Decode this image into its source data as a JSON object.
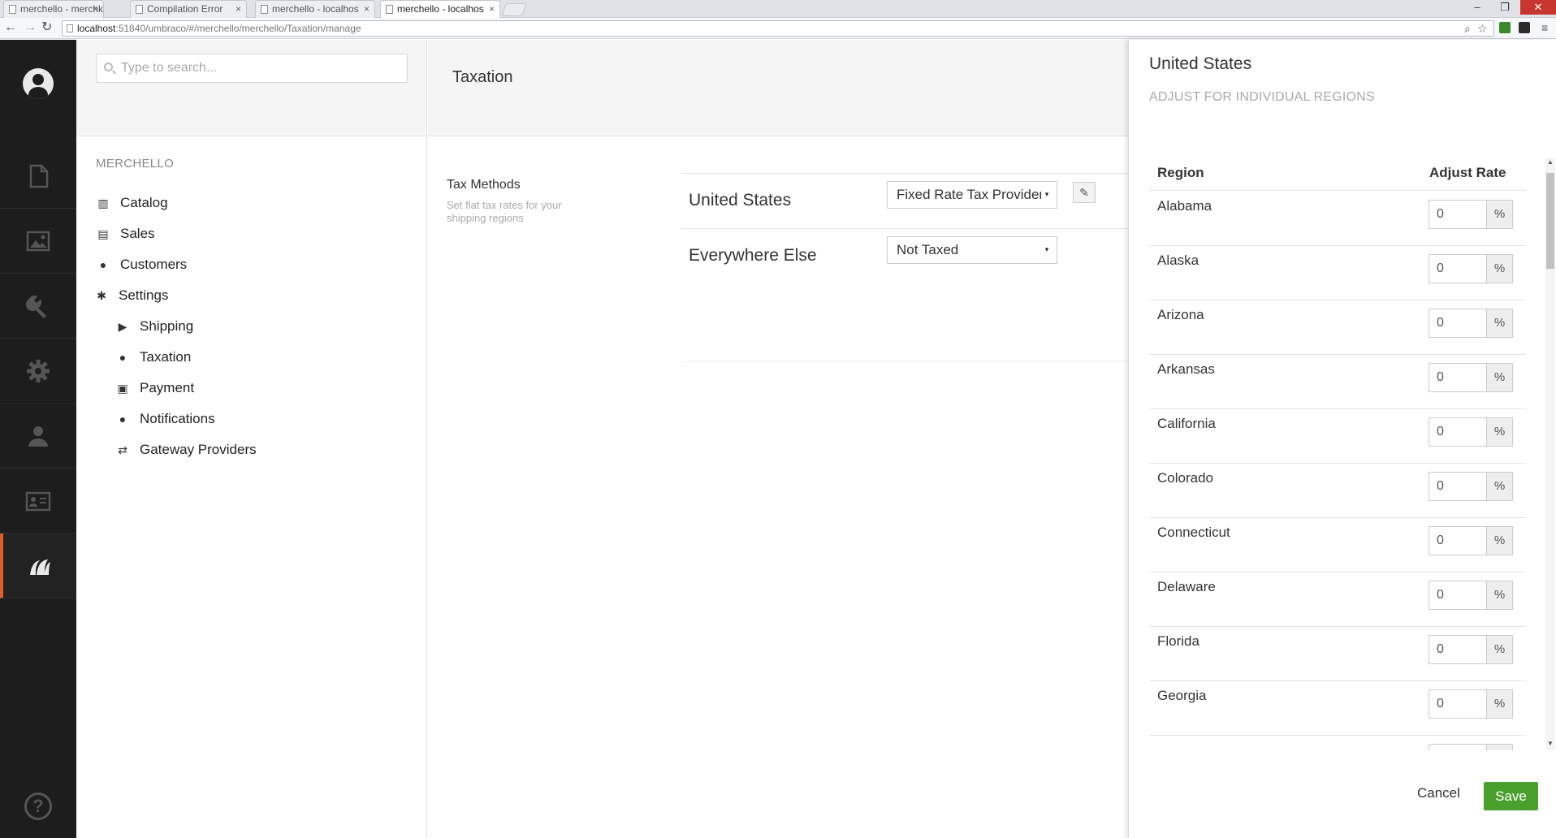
{
  "browser": {
    "tabs": [
      {
        "label": "merchello - merchkit",
        "active": false
      },
      {
        "label": "Compilation Error",
        "active": false
      },
      {
        "label": "merchello - localhos",
        "active": false
      },
      {
        "label": "merchello - localhos",
        "active": true
      }
    ],
    "tab_close": "×",
    "url_host": "localhost",
    "url_rest": ":51840/umbraco/#/merchello/merchello/Taxation/manage",
    "window_controls": {
      "minimize": "–",
      "restore": "❐",
      "close": "✕"
    },
    "nav": {
      "back": "←",
      "forward": "→",
      "reload": "↻"
    },
    "toolbar_icons": {
      "zoom": "⌕",
      "star": "☆",
      "menu": "≡"
    },
    "extension_colors": [
      "#3a8a2c",
      "#2b2b2b"
    ]
  },
  "sections": {
    "icons": [
      "document-icon",
      "media-icon",
      "wrench-icon",
      "gear-icon",
      "user-icon",
      "member-card-icon",
      "merchello-icon"
    ],
    "active_index": 6,
    "accent_color": "#e05c28",
    "help_label": "?"
  },
  "tree": {
    "search_placeholder": "Type to search...",
    "root_label": "MERCHELLO",
    "nodes": [
      {
        "label": "Catalog",
        "icon": "barcode-icon",
        "glyph": "▥"
      },
      {
        "label": "Sales",
        "icon": "receipt-icon",
        "glyph": "▤"
      },
      {
        "label": "Customers",
        "icon": "person-icon",
        "glyph": "●"
      },
      {
        "label": "Settings",
        "icon": "gear-icon",
        "glyph": "✱"
      }
    ],
    "children": [
      {
        "label": "Shipping",
        "icon": "truck-icon",
        "glyph": "▶"
      },
      {
        "label": "Taxation",
        "icon": "piggy-bank-icon",
        "glyph": "●"
      },
      {
        "label": "Payment",
        "icon": "money-icon",
        "glyph": "▣"
      },
      {
        "label": "Notifications",
        "icon": "speech-bubble-icon",
        "glyph": "●"
      },
      {
        "label": "Gateway Providers",
        "icon": "arrows-icon",
        "glyph": "⇄"
      }
    ]
  },
  "main": {
    "title": "Taxation",
    "tax_methods_title": "Tax Methods",
    "tax_methods_desc": "Set flat tax rates for your shipping regions",
    "rows": [
      {
        "country": "United States",
        "provider": "Fixed Rate Tax Provider"
      },
      {
        "country": "Everywhere Else",
        "provider": "Not Taxed"
      }
    ],
    "select_caret": "▾",
    "edit_glyph": "✎"
  },
  "dialog": {
    "title": "United States",
    "subtitle": "ADJUST FOR INDIVIDUAL REGIONS",
    "col_region": "Region",
    "col_rate": "Adjust Rate",
    "percent_label": "%",
    "regions": [
      {
        "name": "Alabama",
        "rate": "0"
      },
      {
        "name": "Alaska",
        "rate": "0"
      },
      {
        "name": "Arizona",
        "rate": "0"
      },
      {
        "name": "Arkansas",
        "rate": "0"
      },
      {
        "name": "California",
        "rate": "0"
      },
      {
        "name": "Colorado",
        "rate": "0"
      },
      {
        "name": "Connecticut",
        "rate": "0"
      },
      {
        "name": "Delaware",
        "rate": "0"
      },
      {
        "name": "Florida",
        "rate": "0"
      },
      {
        "name": "Georgia",
        "rate": "0"
      }
    ],
    "cancel_label": "Cancel",
    "save_label": "Save",
    "save_color": "#4aa02c",
    "scroll_up": "▲",
    "scroll_down": "▼"
  }
}
